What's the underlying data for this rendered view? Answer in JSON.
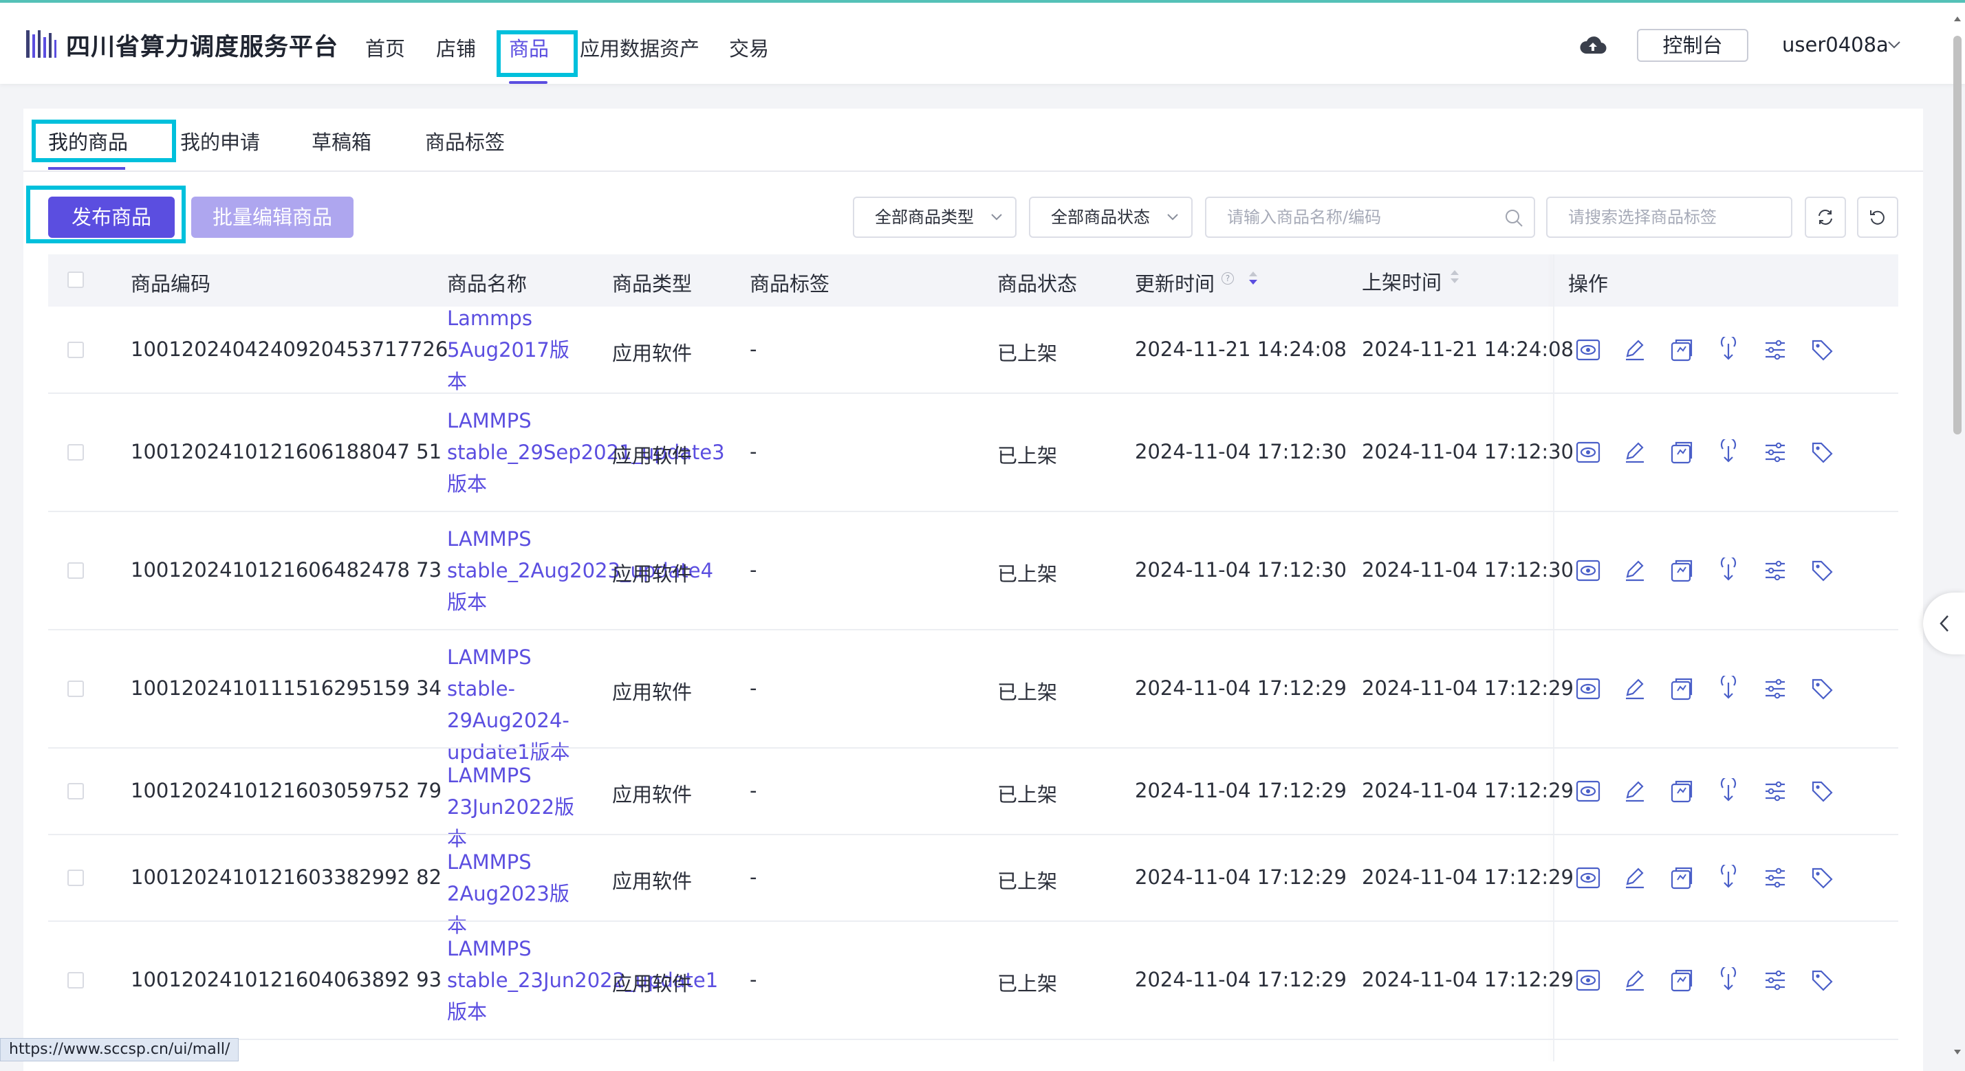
{
  "brand": {
    "title": "四川省算力调度服务平台",
    "accent": "#5b4ee0",
    "highlight": "#00c0dc"
  },
  "nav": {
    "items": [
      {
        "label": "首页"
      },
      {
        "label": "店铺"
      },
      {
        "label": "商品",
        "active": true
      },
      {
        "label": "应用数据资产"
      },
      {
        "label": "交易"
      }
    ],
    "cloud_icon": "cloud-upload-icon",
    "console_label": "控制台",
    "user": "user0408a"
  },
  "tabs": [
    {
      "label": "我的商品",
      "active": true
    },
    {
      "label": "我的申请"
    },
    {
      "label": "草稿箱"
    },
    {
      "label": "商品标签"
    }
  ],
  "toolbar": {
    "publish_label": "发布商品",
    "batch_edit_label": "批量编辑商品",
    "type_filter": "全部商品类型",
    "status_filter": "全部商品状态",
    "search_placeholder": "请输入商品名称/编码",
    "tag_placeholder": "请搜索选择商品标签"
  },
  "table": {
    "headers": {
      "code": "商品编码",
      "name": "商品名称",
      "type": "商品类型",
      "tag": "商品标签",
      "status": "商品状态",
      "updated": "更新时间",
      "help": "?",
      "listed": "上架时间",
      "ops": "操作"
    },
    "op_icons": [
      "view-icon",
      "edit-icon",
      "copy-icon",
      "download-icon",
      "settings-icon",
      "tag-icon"
    ],
    "rows": [
      {
        "code": "1001202404240920453717726",
        "name": "Lammps 5Aug2017版本",
        "type": "应用软件",
        "tag": "-",
        "status": "已上架",
        "updated": "2024-11-21 14:24:08",
        "listed": "2024-11-21 14:24:08"
      },
      {
        "code": "1001202410121606188047 51",
        "name": "LAMMPS stable_29Sep2021_update3版本",
        "type": "应用软件",
        "tag": "-",
        "status": "已上架",
        "updated": "2024-11-04 17:12:30",
        "listed": "2024-11-04 17:12:30"
      },
      {
        "code": "1001202410121606482478 73",
        "name": "LAMMPS stable_2Aug2023_update4版本",
        "type": "应用软件",
        "tag": "-",
        "status": "已上架",
        "updated": "2024-11-04 17:12:30",
        "listed": "2024-11-04 17:12:30"
      },
      {
        "code": "1001202410111516295159 34",
        "name": "LAMMPS stable-29Aug2024-update1版本",
        "type": "应用软件",
        "tag": "-",
        "status": "已上架",
        "updated": "2024-11-04 17:12:29",
        "listed": "2024-11-04 17:12:29"
      },
      {
        "code": "1001202410121603059752 79",
        "name": "LAMMPS 23Jun2022版本",
        "type": "应用软件",
        "tag": "-",
        "status": "已上架",
        "updated": "2024-11-04 17:12:29",
        "listed": "2024-11-04 17:12:29"
      },
      {
        "code": "1001202410121603382992 82",
        "name": "LAMMPS 2Aug2023版本",
        "type": "应用软件",
        "tag": "-",
        "status": "已上架",
        "updated": "2024-11-04 17:12:29",
        "listed": "2024-11-04 17:12:29"
      },
      {
        "code": "1001202410121604063892 93",
        "name": "LAMMPS stable_23Jun2022_update1版本",
        "type": "应用软件",
        "tag": "-",
        "status": "已上架",
        "updated": "2024-11-04 17:12:29",
        "listed": "2024-11-04 17:12:29"
      }
    ]
  },
  "status_bar_url": "https://www.sccsp.cn/ui/mall/"
}
